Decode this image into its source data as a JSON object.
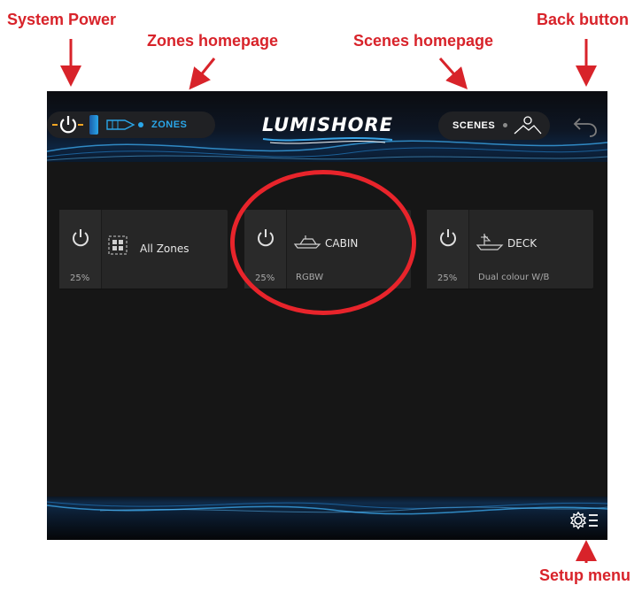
{
  "annotations": {
    "system_power": "System Power",
    "zones_homepage": "Zones homepage",
    "scenes_homepage": "Scenes homepage",
    "back_button": "Back button",
    "setup_menu": "Setup menu"
  },
  "header": {
    "zones_label": "ZONES",
    "logo": "LUMISHORE",
    "scenes_label": "SCENES"
  },
  "zones": [
    {
      "name": "All Zones",
      "level": "25%",
      "type": ""
    },
    {
      "name": "CABIN",
      "level": "25%",
      "type": "RGBW"
    },
    {
      "name": "DECK",
      "level": "25%",
      "type": "Dual colour W/B"
    }
  ],
  "colors": {
    "annotation": "#d8232a",
    "power_accent": "#f5a623",
    "zones_accent": "#2aa6e8"
  }
}
